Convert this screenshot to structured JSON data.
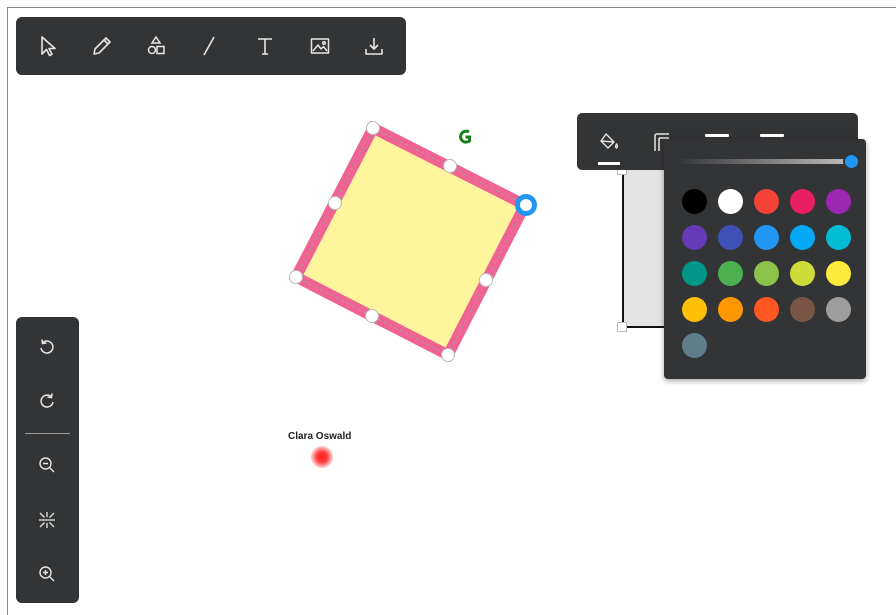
{
  "toolbar": {
    "tools": [
      {
        "name": "select",
        "icon": "pointer-icon"
      },
      {
        "name": "pencil",
        "icon": "pencil-icon"
      },
      {
        "name": "shapes",
        "icon": "shapes-icon"
      },
      {
        "name": "line",
        "icon": "line-icon"
      },
      {
        "name": "text",
        "icon": "text-icon",
        "glyph": "T"
      },
      {
        "name": "image",
        "icon": "image-icon"
      },
      {
        "name": "download",
        "icon": "download-icon"
      }
    ]
  },
  "side_toolbar": {
    "tools": [
      {
        "name": "undo",
        "icon": "undo-icon"
      },
      {
        "name": "redo",
        "icon": "redo-icon"
      },
      {
        "name": "zoom-out",
        "icon": "zoom-out-icon"
      },
      {
        "name": "fit-to-screen",
        "icon": "fit-screen-icon"
      },
      {
        "name": "zoom-in",
        "icon": "zoom-in-icon"
      }
    ]
  },
  "selected_shape": {
    "type": "rectangle",
    "fill_color": "#fff59d",
    "stroke_color": "#f06292",
    "selection_color": "#2196f3",
    "rotate_handle_color": "#1b7f1b"
  },
  "remote_cursor": {
    "user": "Clara Oswald",
    "color": "#ff1a1a"
  },
  "style_toolbar": {
    "items": [
      {
        "name": "fill-color",
        "icon": "paint-bucket-icon"
      },
      {
        "name": "stroke-style",
        "icon": "stroke-style-icon"
      },
      {
        "name": "stroke-width-thin",
        "icon": "line-thin-icon"
      },
      {
        "name": "stroke-width-medium",
        "icon": "line-medium-icon"
      }
    ]
  },
  "color_picker": {
    "opacity": 1.0,
    "colors": [
      "#000000",
      "#ffffff",
      "#f44336",
      "#e91e63",
      "#9c27b0",
      "#673ab7",
      "#3f51b5",
      "#2196f3",
      "#03a9f4",
      "#00bcd4",
      "#009688",
      "#4caf50",
      "#8bc34a",
      "#cddc39",
      "#ffeb3b",
      "#ffc107",
      "#ff9800",
      "#ff5722",
      "#795548",
      "#9e9e9e",
      "#607d8b"
    ]
  }
}
